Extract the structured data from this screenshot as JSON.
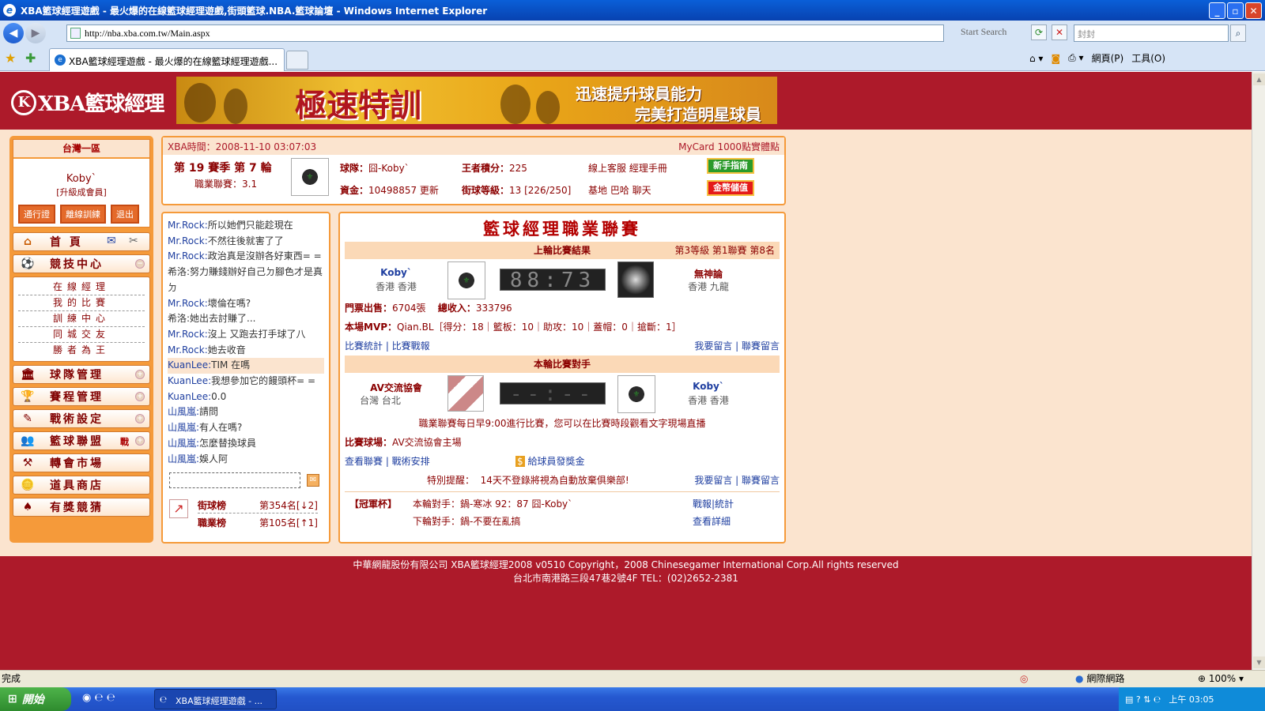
{
  "window": {
    "title": "XBA籃球經理遊戲 - 最火爆的在線籃球經理遊戲,街頭籃球.NBA.籃球論壇 - Windows Internet Explorer",
    "btn_min": "_",
    "btn_restore": "▫",
    "btn_close": "✕"
  },
  "browser": {
    "url": "http://nba.xba.com.tw/Main.aspx",
    "start_search": "Start Search",
    "search_value": "封封",
    "tab_title": "XBA籃球經理遊戲 - 最火爆的在線籃球經理遊戲...",
    "home_label": "網頁(P)",
    "tools_label": "工具(O)",
    "status": "完成",
    "zone": "網際網路",
    "zoom": "100%"
  },
  "header": {
    "logo": "XBA籃球經理",
    "banner_title": "極速特訓",
    "banner_line1": "迅速提升球員能力",
    "banner_line2": "完美打造明星球員"
  },
  "sidebar": {
    "area": "台灣一區",
    "username": "Koby`",
    "rank": "[升級成會員]",
    "buttons": [
      "通行證",
      "離線訓練",
      "退出"
    ],
    "home": "首 頁",
    "menu": [
      {
        "label": "競技中心",
        "icon": "⚽"
      },
      {
        "label": "球隊管理",
        "icon": "🏛"
      },
      {
        "label": "賽程管理",
        "icon": "🏆"
      },
      {
        "label": "戰術設定",
        "icon": "✎"
      },
      {
        "label": "籃球聯盟",
        "icon": "👥"
      },
      {
        "label": "轉會市場",
        "icon": "⚒"
      },
      {
        "label": "道具商店",
        "icon": "🪙"
      },
      {
        "label": "有獎競猜",
        "icon": "♠"
      }
    ],
    "submenu": [
      "在線經理",
      "我的比賽",
      "訓練中心",
      "同城交友",
      "勝者為王"
    ],
    "league_tag": "戰"
  },
  "info": {
    "time": "XBA時間：2008-11-10 03:07:03",
    "promo": "MyCard 1000點實體點",
    "season": "第 19 賽季 第 7 輪",
    "league_rank": "職業聯賽：3.1",
    "team_label": "球隊：",
    "team": "囧-Koby`",
    "points_label": "王者積分：",
    "points": "225",
    "links1": "線上客服  經理手冊",
    "funds_label": "資金：",
    "funds": "10498857",
    "update": "更新",
    "level_label": "街球等級：",
    "level": "13 [226/250]",
    "links2": "基地  巴哈  聊天",
    "btn_guide": "新手指南",
    "btn_gold": "金幣儲值"
  },
  "chat": [
    {
      "name": "Mr.Rock:",
      "text": "所以她們只能趁現在",
      "hl": false
    },
    {
      "name": "Mr.Rock:",
      "text": "不然往後就害了了",
      "hl": false
    },
    {
      "name": "Mr.Rock:",
      "text": "政治真是沒辦各好東西= =",
      "hl": false
    },
    {
      "name": "",
      "text": "希洛:努力賺錢辦好自己ㄉ腳色才是真ㄉ",
      "hl": false
    },
    {
      "name": "Mr.Rock:",
      "text": "壞倫在嗎?",
      "hl": false
    },
    {
      "name": "",
      "text": "希洛:她出去討賺了...",
      "hl": false
    },
    {
      "name": "Mr.Rock:",
      "text": "沒上 又跑去打手球了八",
      "hl": false
    },
    {
      "name": "Mr.Rock:",
      "text": "她去收音",
      "hl": false
    },
    {
      "name": "KuanLee:",
      "text": "TIM 在嗎",
      "hl": true
    },
    {
      "name": "KuanLee:",
      "text": "我想參加它的饅頭杯= =",
      "hl": false
    },
    {
      "name": "KuanLee:",
      "text": "0.0",
      "hl": false
    },
    {
      "name": "山風嵐:",
      "text": "請問",
      "hl": false
    },
    {
      "name": "山風嵐:",
      "text": "有人在嗎?",
      "hl": false
    },
    {
      "name": "山風嵐:",
      "text": "怎麼替換球員",
      "hl": false
    },
    {
      "name": "山風嵐:",
      "text": "娛人阿",
      "hl": false
    }
  ],
  "ranks": [
    {
      "label": "街球榜",
      "value": "第354名[↓2]"
    },
    {
      "label": "職業榜",
      "value": "第105名[↑1]"
    }
  ],
  "league": {
    "title": "籃球經理職業聯賽",
    "last_result": "上輪比賽結果",
    "last_right": "第3等級  第1聯賽  第8名",
    "home_team": "Koby`",
    "home_loc": "香港 香港",
    "score": "88:73",
    "away_team": "無神論",
    "away_loc": "香港 九龍",
    "ticket_label": "門票出售：",
    "ticket": "6704張",
    "income_label": "總收入：",
    "income": "333796",
    "mvp_label": "本場MVP：",
    "mvp": "Qian.BL［得分：18｜籃板：10｜助攻：10｜蓋帽：0｜搶斷：1］",
    "links_left": "比賽統計 | 比賽戰報",
    "links_right": "我要留言 | 聯賽留言",
    "next_band": "本輪比賽對手",
    "opp_team": "AV交流協會",
    "opp_loc": "台灣 台北",
    "next_score": "--:--",
    "my_team": "Koby`",
    "my_loc": "香港 香港",
    "notice": "職業聯賽每日早9:00進行比賽，您可以在比賽時段觀看文字現場直播",
    "venue_label": "比賽球場：",
    "venue": "AV交流協會主場",
    "links2_left": "查看聯賽 | 戰術安排",
    "bonus": "給球員發獎金",
    "reminder_label": "特別提醒：",
    "reminder": "14天不登錄將視為自動放棄俱樂部!",
    "links2_right": "我要留言 | 聯賽留言",
    "cup": "【冠軍杯】",
    "cup_line1": "本輪對手：鍋-寒冰  92：87 囧-Koby`",
    "cup_line1_link": "戰報|統計",
    "cup_line2": "下輪對手：鍋-不要在亂搞",
    "cup_line2_link": "查看詳細"
  },
  "footer": {
    "line1": "中華網龍股份有限公司  XBA籃球經理2008 v0510     Copyright，2008 Chinesegamer International Corp.All rights reserved",
    "line2": "台北市南港路三段47巷2號4F TEL：(02)2652-2381"
  },
  "taskbar": {
    "start": "開始",
    "task": "XBA籃球經理遊戲 - ...",
    "clock": "上午 03:05"
  }
}
